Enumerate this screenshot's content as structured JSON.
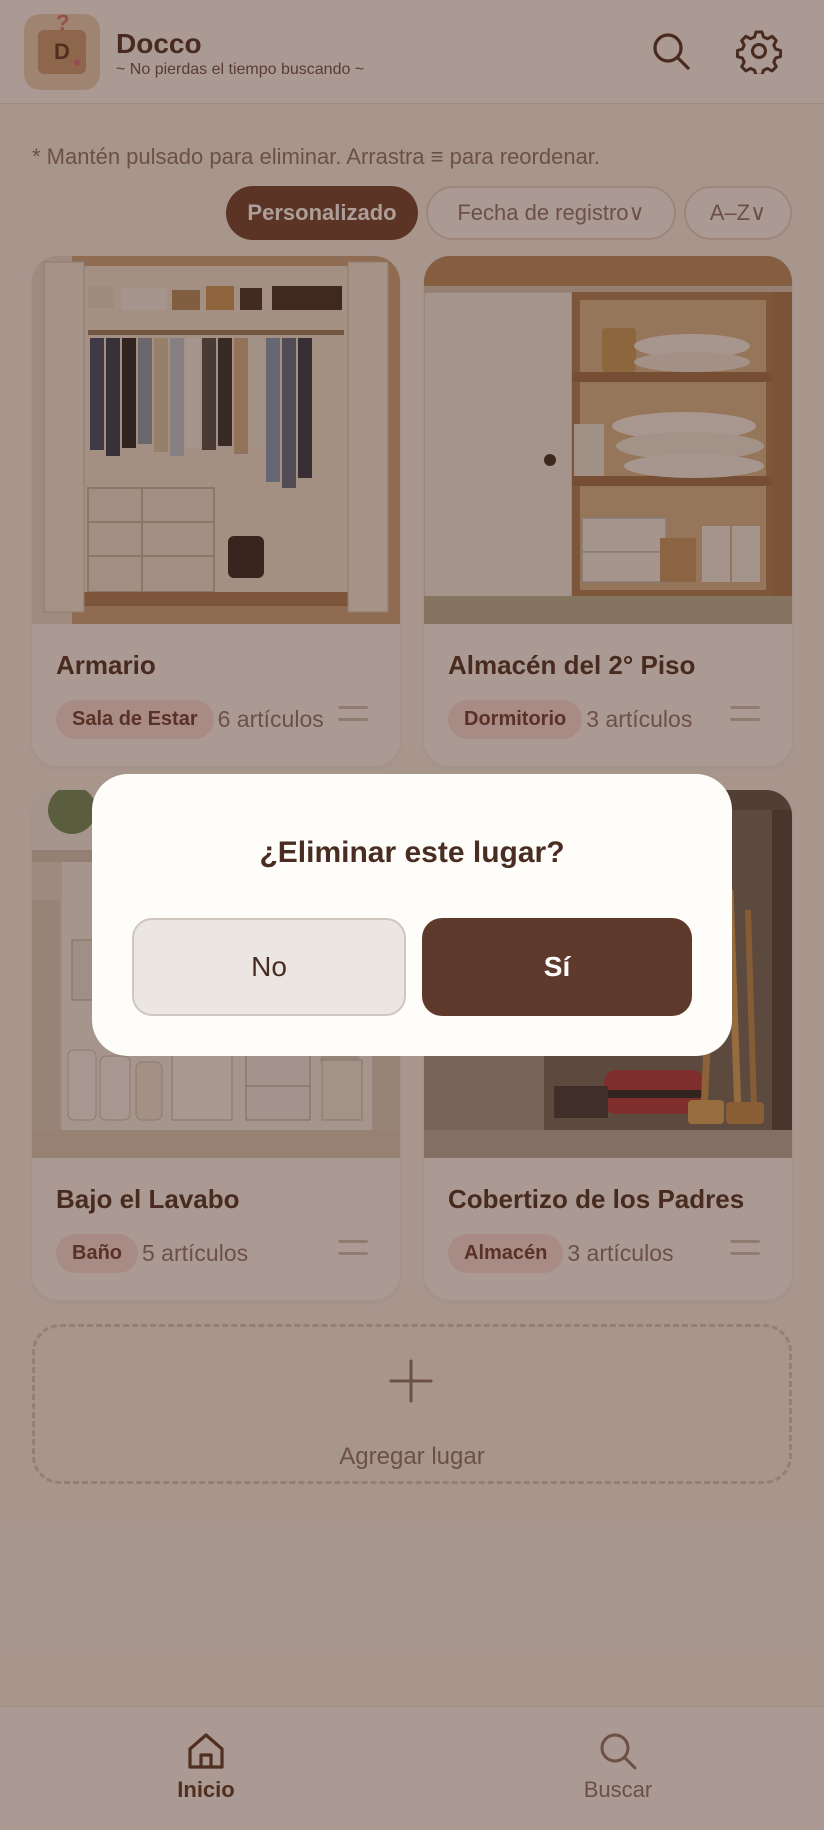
{
  "header": {
    "title": "Docco",
    "subtitle": "~ No pierdas el tiempo buscando ~"
  },
  "hint": "* Mantén pulsado para eliminar. Arrastra ≡ para reordenar.",
  "sort": {
    "custom": "Personalizado",
    "date": "Fecha de registro∨",
    "az": "A–Z∨"
  },
  "places": [
    {
      "name": "Armario",
      "tag": "Sala de Estar",
      "count": "6 artículos"
    },
    {
      "name": "Almacén del 2° Piso",
      "tag": "Dormitorio",
      "count": "3 artículos"
    },
    {
      "name": "Bajo el Lavabo",
      "tag": "Baño",
      "count": "5 artículos"
    },
    {
      "name": "Cobertizo de los Padres",
      "tag": "Almacén",
      "count": "3 artículos"
    }
  ],
  "add_place": "Agregar lugar",
  "nav": {
    "home": "Inicio",
    "search": "Buscar"
  },
  "dialog": {
    "title": "¿Eliminar este lugar?",
    "no": "No",
    "yes": "Sí"
  },
  "colors": {
    "primary": "#6e3e2c",
    "background": "#f7f1ea",
    "tag_bg": "#f6dcd9"
  }
}
